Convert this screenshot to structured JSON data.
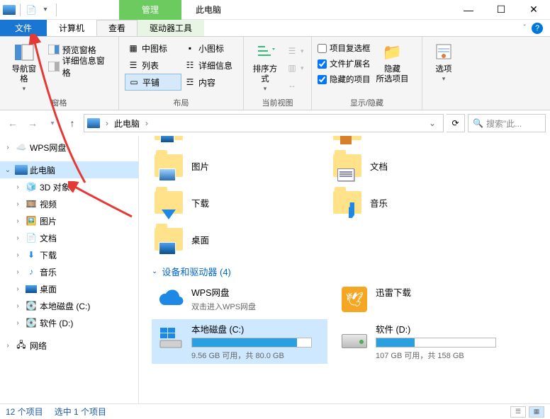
{
  "titlebar": {
    "manage_tab": "管理",
    "title": "此电脑"
  },
  "tabs": {
    "file": "文件",
    "computer": "计算机",
    "view": "查看",
    "drive_tools": "驱动器工具"
  },
  "ribbon": {
    "panes": {
      "label": "窗格",
      "nav": "导航窗格",
      "preview": "预览窗格",
      "details": "详细信息窗格"
    },
    "layout": {
      "label": "布局",
      "medium": "中图标",
      "small": "小图标",
      "list": "列表",
      "details": "详细信息",
      "tiles": "平铺",
      "content": "内容"
    },
    "current_view": {
      "label": "当前视图",
      "sort": "排序方式"
    },
    "show_hide": {
      "label": "显示/隐藏",
      "item_checkboxes": "项目复选框",
      "file_ext": "文件扩展名",
      "hidden_items": "隐藏的项目",
      "hide": "隐藏\n所选项目"
    },
    "options": {
      "label": "",
      "options_btn": "选项"
    }
  },
  "addr": {
    "root": "此电脑",
    "search_placeholder": "搜索\"此..."
  },
  "sidebar": {
    "wps": "WPS网盘",
    "this_pc": "此电脑",
    "objects3d": "3D 对象",
    "videos": "视频",
    "pictures": "图片",
    "documents": "文档",
    "downloads": "下载",
    "music": "音乐",
    "desktop": "桌面",
    "local_c": "本地磁盘 (C:)",
    "software_d": "软件 (D:)",
    "network": "网络"
  },
  "content": {
    "folders": {
      "pictures": "图片",
      "documents": "文档",
      "downloads": "下载",
      "music": "音乐",
      "desktop": "桌面"
    },
    "devices_header": "设备和驱动器 (4)",
    "wps": {
      "name": "WPS网盘",
      "sub": "双击进入WPS网盘"
    },
    "xunlei": {
      "name": "迅雷下载"
    },
    "drive_c": {
      "name": "本地磁盘 (C:)",
      "status": "9.56 GB 可用，共 80.0 GB",
      "pct": 88
    },
    "drive_d": {
      "name": "软件 (D:)",
      "status": "107 GB 可用，共 158 GB",
      "pct": 32
    }
  },
  "status": {
    "items": "12 个项目",
    "selected": "选中 1 个项目"
  }
}
